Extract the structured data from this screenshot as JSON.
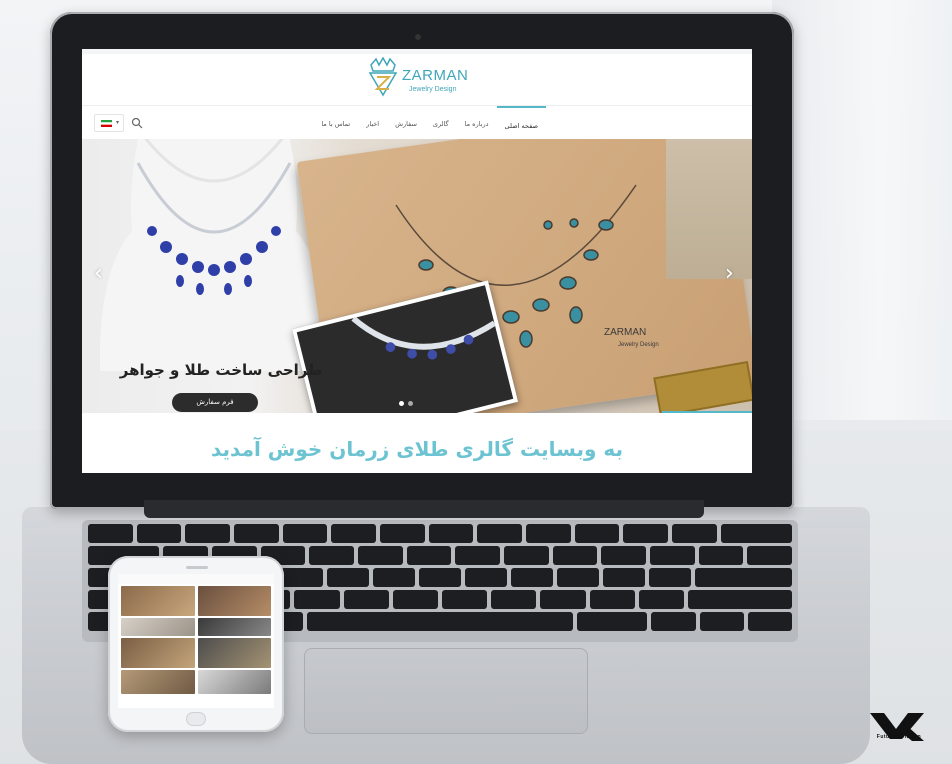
{
  "site": {
    "logo_name": "ZARMAN",
    "logo_tagline": "Jewelry Design",
    "accent_color": "#55b8c9",
    "welcome_text": "به وبسایت گالری طلای زرمان خوش آمدید"
  },
  "nav": {
    "items": [
      {
        "label": "صفحه اصلی",
        "active": true
      },
      {
        "label": "درباره ما",
        "active": false
      },
      {
        "label": "گالری",
        "active": false
      },
      {
        "label": "سفارش",
        "active": false
      },
      {
        "label": "اخبار",
        "active": false
      },
      {
        "label": "تماس با ما",
        "active": false
      }
    ],
    "search_icon": "search-icon",
    "language_flag": "iran-flag-icon"
  },
  "hero": {
    "title": "طراحی ساخت طلا و جواهر",
    "button_label": "فرم سفارش",
    "prev_icon": "chevron-left-icon",
    "next_icon": "chevron-right-icon",
    "slide_count": 2,
    "active_slide": 1,
    "image_logo_name": "ZARMAN",
    "image_logo_tagline": "Jewelry Design"
  },
  "watermark": {
    "text": "Future Solution"
  }
}
